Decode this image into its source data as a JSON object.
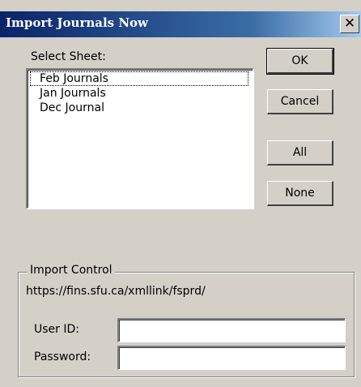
{
  "window": {
    "title": "Import Journals Now",
    "close_glyph": "✕"
  },
  "sheet_select": {
    "label": "Select Sheet:",
    "items": [
      "Feb Journals",
      "Jan Journals",
      "Dec Journal"
    ],
    "focused_item": "Feb Journals"
  },
  "buttons": {
    "ok": "OK",
    "cancel": "Cancel",
    "all": "All",
    "none": "None"
  },
  "import_control": {
    "legend": "Import Control",
    "url": "https://fins.sfu.ca/xmllink/fsprd/",
    "user_id_label": "User ID:",
    "user_id_value": "",
    "password_label": "Password:",
    "password_value": ""
  }
}
